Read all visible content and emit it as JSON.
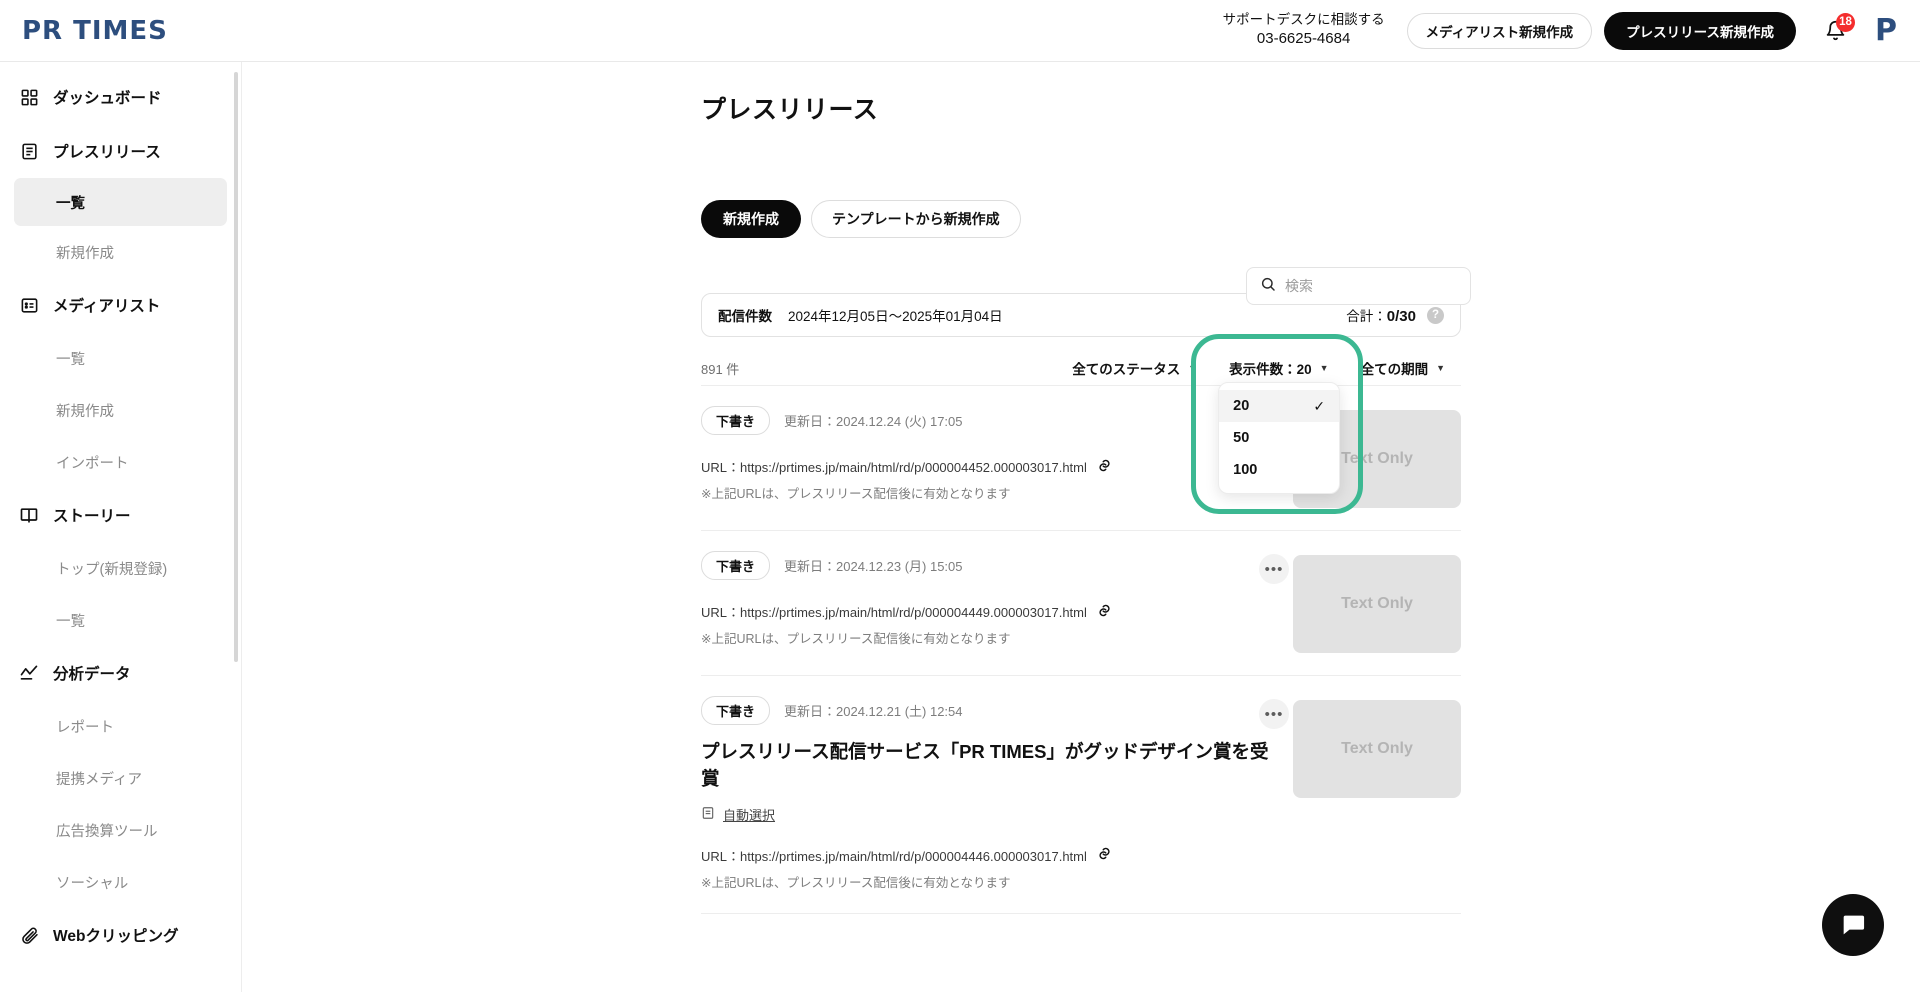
{
  "header": {
    "logo_text": "PR TIMES",
    "support_label": "サポートデスクに相談する",
    "support_phone": "03-6625-4684",
    "medialist_new_label": "メディアリスト新規作成",
    "press_new_label": "プレスリリース新規作成",
    "notification_count": "18",
    "avatar_letter": "P"
  },
  "sidebar": {
    "groups": [
      {
        "icon": "dashboard-icon",
        "label": "ダッシュボード",
        "children": []
      },
      {
        "icon": "document-icon",
        "label": "プレスリリース",
        "children": [
          {
            "label": "一覧",
            "active": true
          },
          {
            "label": "新規作成",
            "active": false
          }
        ]
      },
      {
        "icon": "medialist-icon",
        "label": "メディアリスト",
        "children": [
          {
            "label": "一覧",
            "active": false
          },
          {
            "label": "新規作成",
            "active": false
          },
          {
            "label": "インポート",
            "active": false
          }
        ]
      },
      {
        "icon": "book-icon",
        "label": "ストーリー",
        "children": [
          {
            "label": "トップ(新規登録)",
            "active": false
          },
          {
            "label": "一覧",
            "active": false
          }
        ]
      },
      {
        "icon": "analytics-icon",
        "label": "分析データ",
        "children": [
          {
            "label": "レポート",
            "active": false
          },
          {
            "label": "提携メディア",
            "active": false
          },
          {
            "label": "広告換算ツール",
            "active": false
          },
          {
            "label": "ソーシャル",
            "active": false
          }
        ]
      },
      {
        "icon": "clip-icon",
        "label": "Webクリッピング",
        "children": []
      }
    ]
  },
  "main": {
    "page_title": "プレスリリース",
    "new_button_label": "新規作成",
    "template_button_label": "テンプレートから新規作成",
    "search": {
      "placeholder": "検索",
      "value": "",
      "icon": "search-icon"
    },
    "distribution": {
      "label": "配信件数",
      "range": "2024年12月05日〜2025年01月04日",
      "total_label": "合計：",
      "total_value": "0/30",
      "help_icon_label": "?"
    },
    "filter_row": {
      "count_text": "891 件",
      "status_filter_label": "全てのステータス",
      "display_count_label": "表示件数：20",
      "period_filter_label": "全ての期間"
    },
    "display_count_dropdown": {
      "open": true,
      "selected": "20",
      "highlight_color": "#3cb892",
      "options": [
        {
          "label": "20",
          "selected": true
        },
        {
          "label": "50",
          "selected": false
        },
        {
          "label": "100",
          "selected": false
        }
      ]
    },
    "releases": [
      {
        "status": "下書き",
        "updated": "更新日：2024.12.24 (火) 17:05",
        "title": "",
        "auto_select": "",
        "url": "URL：https://prtimes.jp/main/html/rd/p/000004452.000003017.html",
        "note": "※上記URLは、プレスリリース配信後に有効となります",
        "thumb_text": "Text Only",
        "menu_icon": "ellipsis-icon"
      },
      {
        "status": "下書き",
        "updated": "更新日：2024.12.23 (月) 15:05",
        "title": "",
        "auto_select": "",
        "url": "URL：https://prtimes.jp/main/html/rd/p/000004449.000003017.html",
        "note": "※上記URLは、プレスリリース配信後に有効となります",
        "thumb_text": "Text Only",
        "menu_icon": "ellipsis-icon"
      },
      {
        "status": "下書き",
        "updated": "更新日：2024.12.21 (土) 12:54",
        "title": "プレスリリース配信サービス「PR TIMES」がグッドデザイン賞を受賞",
        "auto_select": "自動選択",
        "url": "URL：https://prtimes.jp/main/html/rd/p/000004446.000003017.html",
        "note": "※上記URLは、プレスリリース配信後に有効となります",
        "thumb_text": "Text Only",
        "menu_icon": "ellipsis-icon"
      }
    ]
  },
  "chat": {
    "icon": "chat-bubble-icon"
  }
}
